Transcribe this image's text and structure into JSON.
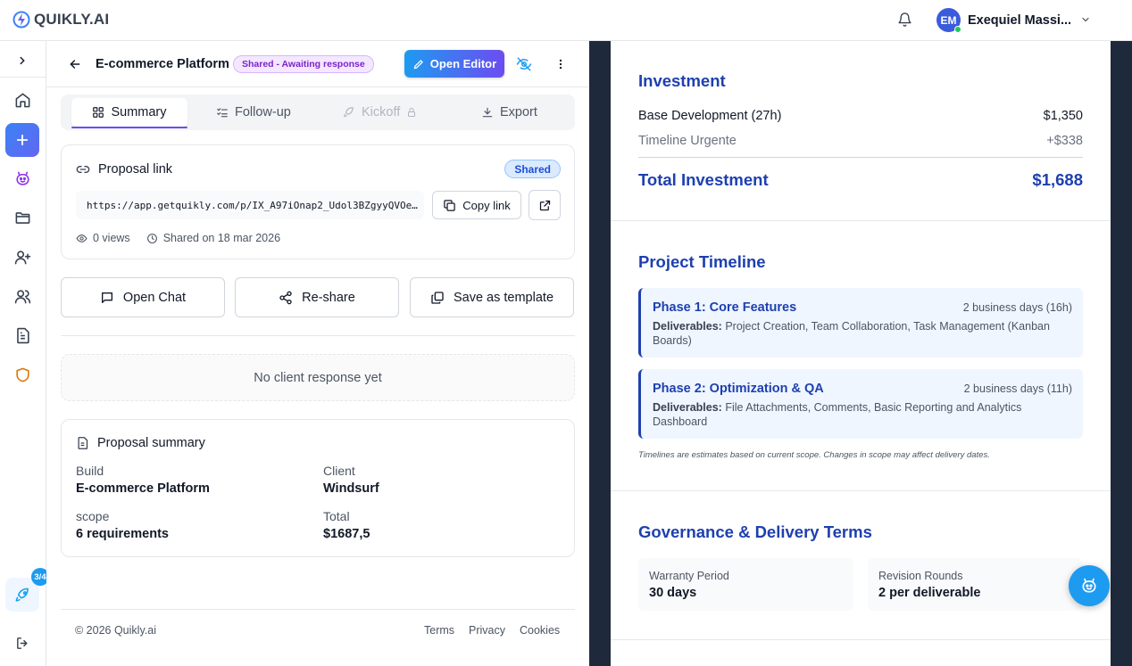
{
  "app": {
    "logo_text": "QUIKLY.AI"
  },
  "user": {
    "initials": "EM",
    "name": "Exequiel Massi..."
  },
  "rail": {
    "progress_badge": "3/4"
  },
  "header": {
    "project_title": "E-commerce Platform",
    "status": "Shared - Awaiting response",
    "open_editor_label": "Open Editor"
  },
  "tabs": [
    {
      "label": "Summary"
    },
    {
      "label": "Follow-up"
    },
    {
      "label": "Kickoff"
    },
    {
      "label": "Export"
    }
  ],
  "proposal_link": {
    "title": "Proposal link",
    "badge": "Shared",
    "url": "https://app.getquikly.com/p/IX_A97iOnap2_Udol3BZgyyQVOe…",
    "copy_label": "Copy link",
    "views": "0 views",
    "shared_on": "Shared on 18 mar 2026"
  },
  "actions": {
    "open_chat": "Open Chat",
    "reshare": "Re-share",
    "save_template": "Save as template"
  },
  "client_response": {
    "empty_text": "No client response yet"
  },
  "summary": {
    "title": "Proposal summary",
    "build_label": "Build",
    "build_value": "E-commerce Platform",
    "client_label": "Client",
    "client_value": "Windsurf",
    "scope_label": "scope",
    "scope_value": "6 requirements",
    "total_label": "Total",
    "total_value": "$1687,5"
  },
  "footer": {
    "copyright": "© 2026 Quikly.ai",
    "terms": "Terms",
    "privacy": "Privacy",
    "cookies": "Cookies"
  },
  "preview": {
    "investment": {
      "title": "Investment",
      "base_label": "Base Development (27h)",
      "base_value": "$1,350",
      "urgent_label": "Timeline Urgente",
      "urgent_value": "+$338",
      "total_label": "Total Investment",
      "total_value": "$1,688"
    },
    "timeline": {
      "title": "Project Timeline",
      "deliverables_prefix": "Deliverables:",
      "phases": [
        {
          "title": "Phase 1: Core Features",
          "duration": "2 business days (16h)",
          "deliverables": "Project Creation, Team Collaboration, Task Management (Kanban Boards)"
        },
        {
          "title": "Phase 2: Optimization & QA",
          "duration": "2 business days (11h)",
          "deliverables": "File Attachments, Comments, Basic Reporting and Analytics Dashboard"
        }
      ],
      "note": "Timelines are estimates based on current scope. Changes in scope may affect delivery dates."
    },
    "governance": {
      "title": "Governance & Delivery Terms",
      "warranty_label": "Warranty Period",
      "warranty_value": "30 days",
      "revision_label": "Revision Rounds",
      "revision_value": "2 per deliverable"
    }
  },
  "colors": {
    "accent_blue": "#1e40af",
    "brand_gradient_start": "#1d9bf0",
    "brand_gradient_end": "#6d4cf0",
    "status_purple": "#7e22ce",
    "online_green": "#22c55e"
  }
}
